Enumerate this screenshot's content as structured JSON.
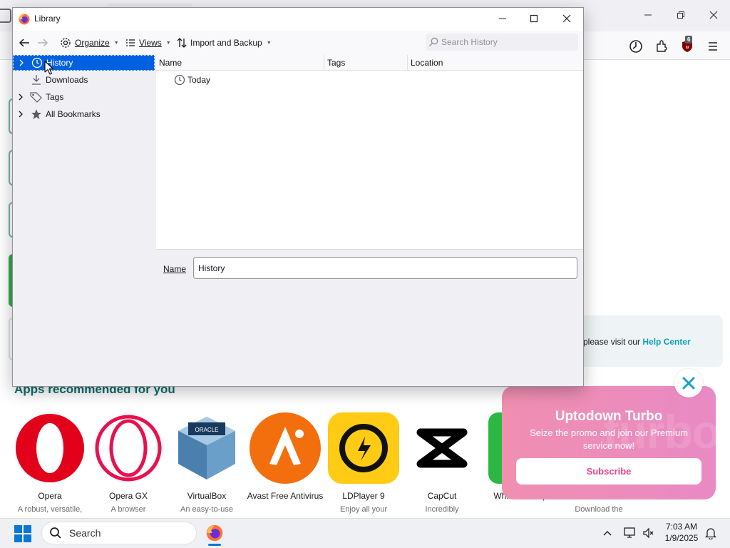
{
  "library_window": {
    "title": "Library",
    "toolbar": {
      "organize": "Organize",
      "views": "Views",
      "import_backup": "Import and Backup",
      "search_placeholder": "Search History"
    },
    "sidebar": {
      "items": [
        {
          "label": "History",
          "icon": "clock-icon",
          "selected": true
        },
        {
          "label": "Downloads",
          "icon": "download-icon"
        },
        {
          "label": "Tags",
          "icon": "tag-icon"
        },
        {
          "label": "All Bookmarks",
          "icon": "star-icon"
        }
      ]
    },
    "columns": {
      "name": "Name",
      "tags": "Tags",
      "location": "Location"
    },
    "rows": [
      {
        "name": "Today",
        "icon": "clock-icon"
      }
    ],
    "details": {
      "name_label": "Name",
      "name_value": "History"
    }
  },
  "browser": {
    "help_text": "please visit our ",
    "help_link": "Help Center",
    "ublock_count": "6",
    "apps_heading": "Apps recommended for you",
    "apps": [
      {
        "name": "Opera",
        "desc": "A robust, versatile,"
      },
      {
        "name": "Opera GX",
        "desc": "A browser"
      },
      {
        "name": "VirtualBox",
        "desc": "An easy-to-use"
      },
      {
        "name": "Avast Free Antivirus",
        "desc": ""
      },
      {
        "name": "LDPlayer 9",
        "desc": "Enjoy all your"
      },
      {
        "name": "CapCut",
        "desc": "Incredibly"
      },
      {
        "name": "Wh... Desktop",
        "desc": "Download the"
      }
    ],
    "promo": {
      "title": "Uptodown Turbo",
      "text": "Seize the promo and join our Premium service now!",
      "button": "Subscribe",
      "watermark": "turbo"
    }
  },
  "taskbar": {
    "search_placeholder": "Search",
    "time": "7:03 AM",
    "date": "1/9/2025"
  },
  "colors": {
    "accent": "#0061e0",
    "help_link": "#0f9fb8",
    "promo_pink": "#e98ac4",
    "apps_heading": "#0a6e70"
  }
}
